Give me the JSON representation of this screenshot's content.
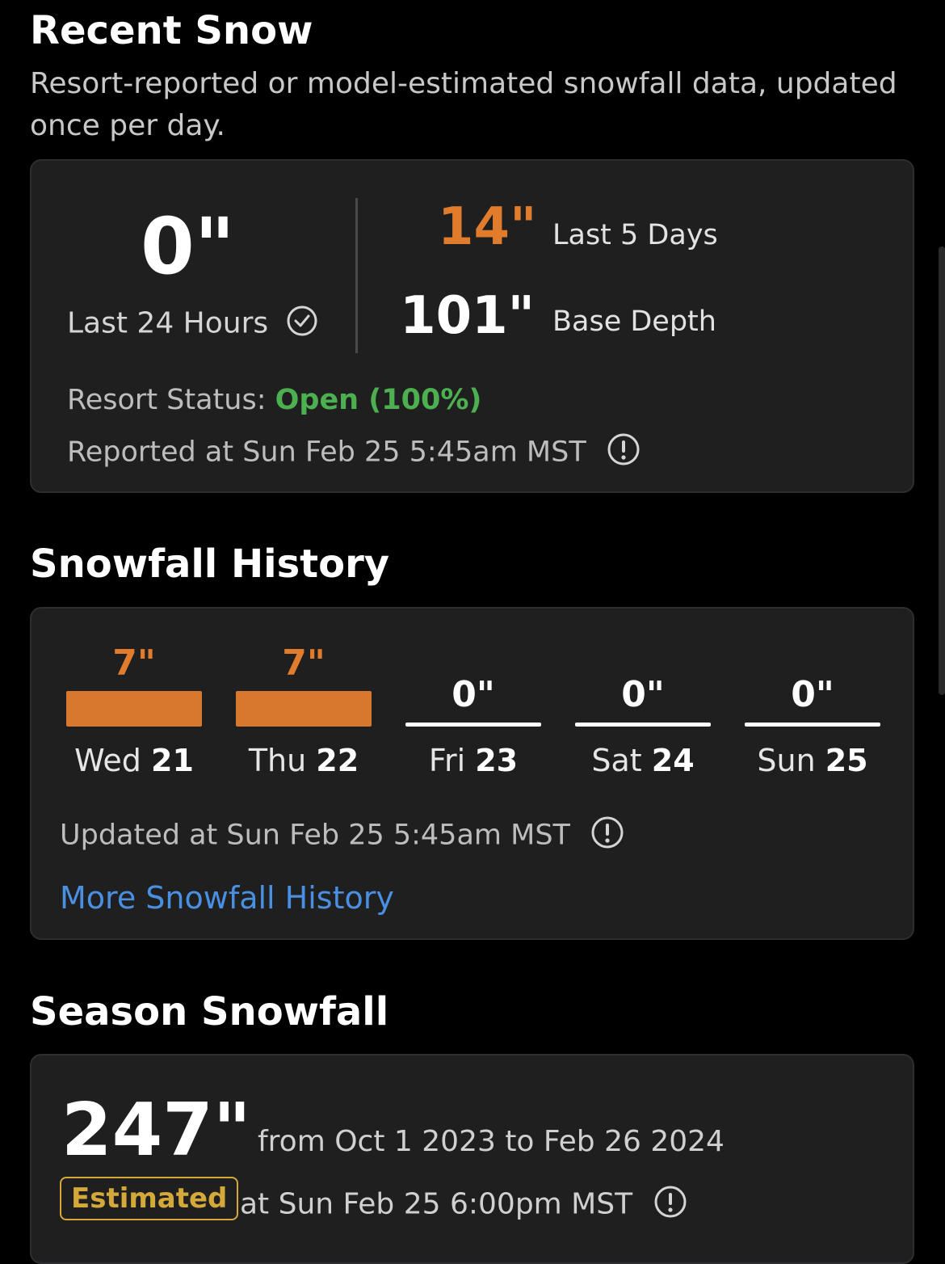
{
  "recent_snow": {
    "title": "Recent Snow",
    "subtitle": "Resort-reported or model-estimated snowfall data, updated once per day.",
    "last_24_value": "0\"",
    "last_24_label": "Last 24 Hours",
    "last_5_value": "14\"",
    "last_5_label": "Last 5 Days",
    "base_depth_value": "101\"",
    "base_depth_label": "Base Depth",
    "status_label": "Resort Status:",
    "status_value": "Open (100%)",
    "reported_text": "Reported at Sun Feb 25 5:45am MST"
  },
  "snowfall_history": {
    "title": "Snowfall History",
    "days": [
      {
        "value": "7\"",
        "day": "Wed",
        "date": "21",
        "inches": 7
      },
      {
        "value": "7\"",
        "day": "Thu",
        "date": "22",
        "inches": 7
      },
      {
        "value": "0\"",
        "day": "Fri",
        "date": "23",
        "inches": 0
      },
      {
        "value": "0\"",
        "day": "Sat",
        "date": "24",
        "inches": 0
      },
      {
        "value": "0\"",
        "day": "Sun",
        "date": "25",
        "inches": 0
      }
    ],
    "updated_text": "Updated at Sun Feb 25 5:45am MST",
    "more_link": "More Snowfall History"
  },
  "season_snowfall": {
    "title": "Season Snowfall",
    "value": "247\"",
    "range_text": "from Oct 1 2023 to Feb 26 2024",
    "badge": "Estimated",
    "estimated_at": "at Sun Feb 25 6:00pm MST"
  },
  "colors": {
    "accent_orange": "#e07c2b",
    "status_green": "#4caf50",
    "link_blue": "#4a90e2",
    "badge_gold": "#d4a93a"
  }
}
